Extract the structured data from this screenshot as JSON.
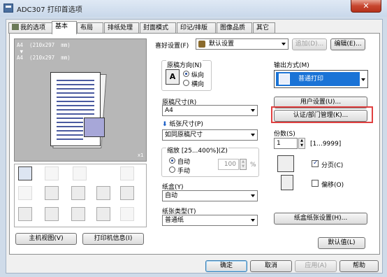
{
  "window": {
    "title": "ADC307 打印首选项",
    "close": "✕"
  },
  "tabs": [
    {
      "label": "我的选项"
    },
    {
      "label": "基本"
    },
    {
      "label": "布局"
    },
    {
      "label": "排纸处理"
    },
    {
      "label": "封面模式"
    },
    {
      "label": "印记/排版"
    },
    {
      "label": "图像品质"
    },
    {
      "label": "其它"
    }
  ],
  "preview": {
    "line1": "A4  (210x297  mm)",
    "arrow": "▼",
    "line2": "A4  (210x297  mm)",
    "zoom": "x1"
  },
  "favorite": {
    "label": "喜好设置(F)",
    "value": "默认设置",
    "add_button": "追加(D)...",
    "edit_button": "编辑(E)..."
  },
  "orientation": {
    "label": "原稿方向(N)",
    "options": [
      "纵向",
      "横向"
    ],
    "selected": "纵向"
  },
  "original_size": {
    "label": "原稿尺寸(R)",
    "value": "A4"
  },
  "paper_size": {
    "label": "纸张尺寸(P)",
    "value": "如同原稿尺寸"
  },
  "zoom": {
    "label": "缩放 [25...400%](Z)",
    "options": [
      "自动",
      "手动"
    ],
    "selected": "自动",
    "value": "100",
    "unit": "%"
  },
  "tray": {
    "label": "纸盒(Y)",
    "value": "自动"
  },
  "paper_type": {
    "label": "纸张类型(T)",
    "value": "普通纸"
  },
  "output": {
    "label": "输出方式(M)",
    "value": "普通打印",
    "user_settings_button": "用户设置(U)...",
    "auth_button": "认证/部门管理(K)..."
  },
  "copies": {
    "label": "份数(S)",
    "value": "1",
    "range": "[1...9999]",
    "collate_label": "分页(C)",
    "collate_checked": true,
    "offset_label": "偏移(O)",
    "offset_checked": false
  },
  "buttons": {
    "paper_tray_settings": "纸盒纸张设置(H)...",
    "defaults": "默认值(L)",
    "host_view": "主机视图(V)",
    "printer_info": "打印机信息(I)",
    "ok": "确定",
    "cancel": "取消",
    "apply": "应用(A)",
    "help": "帮助"
  },
  "colors": {
    "accent": "#1a73d6",
    "highlight": "#e04040"
  }
}
